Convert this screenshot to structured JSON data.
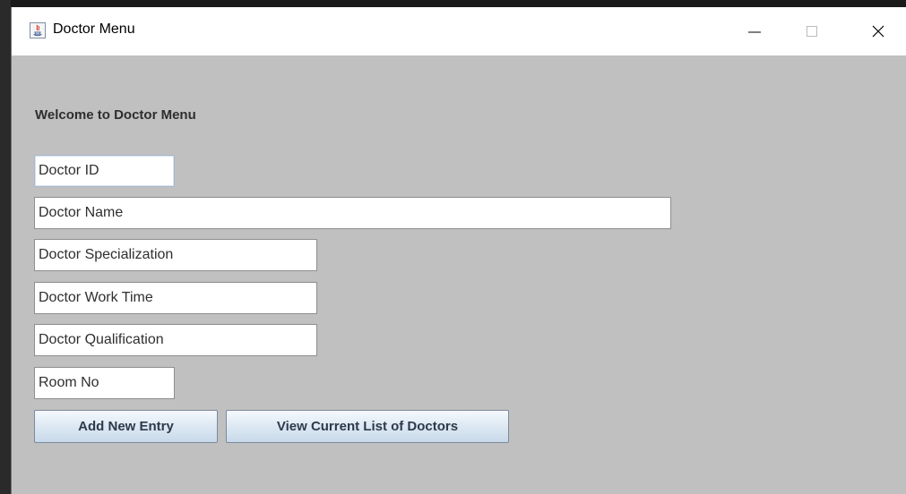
{
  "window": {
    "title": "Doctor Menu"
  },
  "content": {
    "welcome_text": "Welcome to Doctor Menu"
  },
  "fields": {
    "doctor_id": "Doctor ID",
    "doctor_name": "Doctor Name",
    "doctor_specialization": "Doctor Specialization",
    "doctor_work_time": "Doctor Work Time",
    "doctor_qualification": "Doctor Qualification",
    "room_no": "Room No"
  },
  "buttons": {
    "add_new_entry": "Add New Entry",
    "view_current_list": "View Current List of Doctors"
  }
}
